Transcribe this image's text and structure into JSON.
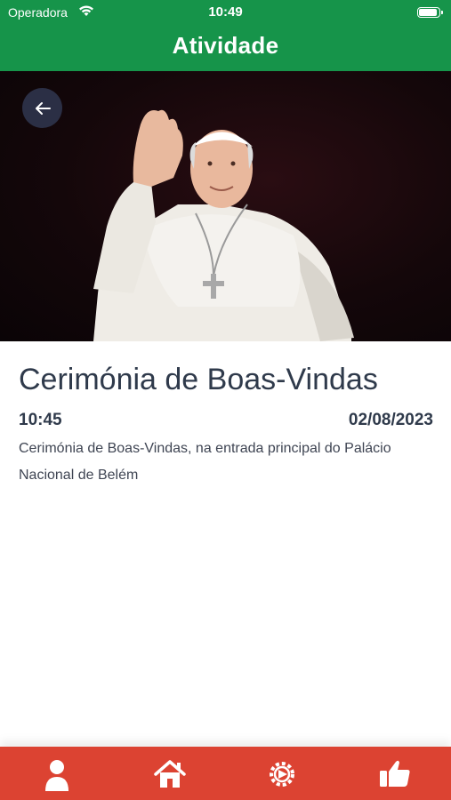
{
  "status_bar": {
    "carrier": "Operadora",
    "time": "10:49",
    "battery_level": 1.0
  },
  "header": {
    "title": "Atividade"
  },
  "hero": {
    "image": "pope-waving-photo"
  },
  "event": {
    "title": "Cerimónia de Boas-Vindas",
    "time": "10:45",
    "date": "02/08/2023",
    "description": "Cerimónia de Boas-Vindas, na entrada principal do Palácio Nacional de Belém"
  },
  "tabbar": {
    "items": [
      {
        "icon": "person-icon"
      },
      {
        "icon": "home-icon"
      },
      {
        "icon": "gear-icon"
      },
      {
        "icon": "thumbs-up-icon"
      }
    ]
  },
  "colors": {
    "header": "#16944a",
    "tabbar": "#dc4332",
    "text": "#2f3a4b",
    "back_button": "#2b2f45"
  }
}
